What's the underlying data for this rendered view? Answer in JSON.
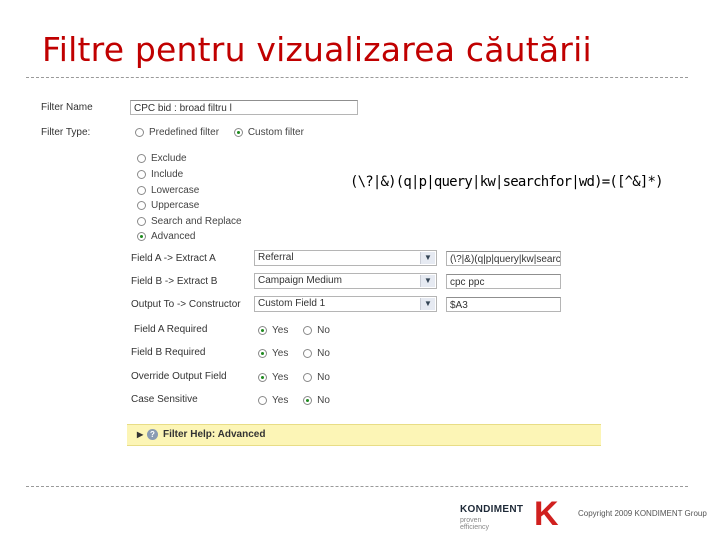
{
  "slide": {
    "title": "Filtre pentru vizualizarea căutării",
    "regex_note": "(\\?|&)(q|p|query|kw|searchfor|wd)=([^&]*)"
  },
  "form": {
    "filter_name_label": "Filter Name",
    "filter_name_value": "CPC bid : broad filtru l",
    "filter_type_label": "Filter Type:",
    "filter_type_options": [
      "Predefined filter",
      "Custom filter"
    ],
    "filter_type_selected": "Custom filter",
    "custom_options": [
      "Exclude",
      "Include",
      "Lowercase",
      "Uppercase",
      "Search and Replace",
      "Advanced"
    ],
    "custom_selected": "Advanced",
    "field_a_label": "Field A -> Extract A",
    "field_a_select": "Referral",
    "field_a_extract": "(\\?|&)(q|p|query|kw|search",
    "field_b_label": "Field B -> Extract B",
    "field_b_select": "Campaign Medium",
    "field_b_extract": "cpc ppc",
    "output_label": "Output To -> Constructor",
    "output_select": "Custom Field 1",
    "output_constructor": "$A3",
    "field_a_required_label": "Field A Required",
    "field_b_required_label": "Field B Required",
    "override_label": "Override Output Field",
    "case_sensitive_label": "Case Sensitive",
    "yes_label": "Yes",
    "no_label": "No",
    "help_text": "Filter Help: Advanced"
  },
  "footer": {
    "logo_word": "KONDIMENT",
    "logo_sub": "proven efficiency",
    "logo_letter": "K",
    "copyright": "Copyright 2009 KONDIMENT Group"
  },
  "colors": {
    "title": "#c00000",
    "help_bar": "#fcf5b6",
    "logo_red": "#d0201f"
  },
  "icons": {
    "help": "question-circle-icon",
    "expand": "triangle-right-icon",
    "dropdown": "chevron-down-icon"
  }
}
